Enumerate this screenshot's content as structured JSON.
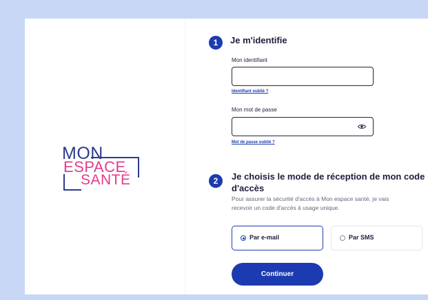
{
  "brand": {
    "logo_lines": [
      "MON",
      "ESPACE",
      "SANTÉ"
    ],
    "colors": {
      "navy": "#2e3a8c",
      "pink": "#e13c8d",
      "primary": "#1c3bb0",
      "page_bg": "#c7d7f5"
    }
  },
  "step1": {
    "number": "1",
    "title": "Je m'identifie",
    "identifier_label": "Mon identifiant",
    "identifier_value": "",
    "identifier_forgot_link": "Identifiant oublié ?",
    "password_label": "Mon mot de passe",
    "password_value": "",
    "password_toggle_icon": "eye-icon",
    "password_forgot_link": "Mot de passe oublié ?"
  },
  "step2": {
    "number": "2",
    "title_line1": "Je choisis le mode de réception de mon code",
    "title_line2": "d'accès",
    "helper_line1": "Pour assurer la sécurité d'accès à Mon espace santé, je vais",
    "helper_line2": "recevoir un code d'accès à usage unique.",
    "options": [
      {
        "label": "Par e-mail",
        "selected": true
      },
      {
        "label": "Par SMS",
        "selected": false
      }
    ]
  },
  "actions": {
    "continue_label": "Continuer"
  }
}
